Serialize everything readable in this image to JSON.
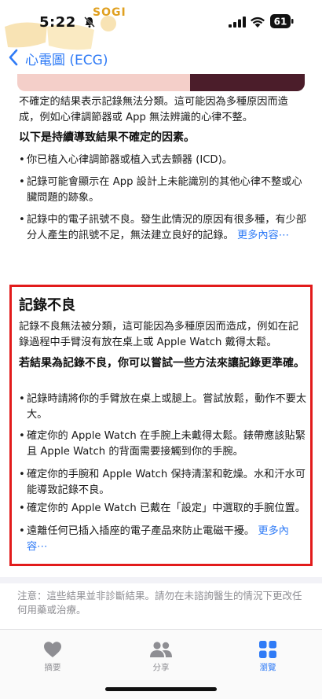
{
  "status_bar": {
    "time": "5:22",
    "watermark": "SOGI",
    "battery": "61"
  },
  "nav": {
    "back_label": "心電圖 (ECG)"
  },
  "intro": {
    "paragraph": "不確定的結果表示記錄無法分類。這可能因為多種原因而造成，例如心律調節器或 App 無法辨識的心律不整。",
    "factors_heading": "以下是持續導致結果不確定的因素。",
    "bullets": [
      "你已植入心律調節器或植入式去顫器 (ICD)。",
      "記錄可能會顯示在 App 設計上未能識別的其他心律不整或心臟問題的跡象。",
      "記錄中的電子訊號不良。發生此情況的原因有很多種，有少部分人產生的訊號不足，無法建立良好的記錄。"
    ],
    "more_label": "更多內容⋯"
  },
  "poor_recording": {
    "title": "記錄不良",
    "paragraph": "記錄不良無法被分類，這可能因為多種原因而造成，例如在記錄過程中手臂沒有放在桌上或 Apple Watch 戴得太鬆。",
    "tips_heading": "若結果為記錄不良，你可以嘗試一些方法來讓記錄更準確。",
    "bullets": [
      "記錄時請將你的手臂放在桌上或腿上。嘗試放鬆，動作不要太大。",
      "確定你的 Apple Watch 在手腕上未戴得太鬆。錶帶應該貼緊且 Apple Watch 的背面需要接觸到你的手腕。",
      "確定你的手腕和 Apple Watch 保持清潔和乾燥。水和汗水可能導致記錄不良。",
      "確定你的 Apple Watch 已戴在「設定」中選取的手腕位置。",
      "遠離任何已插入插座的電子產品來防止電磁干擾。"
    ],
    "more_label": "更多內容⋯"
  },
  "note": "注意：這些結果並非診斷結果。請勿在未諮詢醫生的情況下更改任何用藥或治療。",
  "tabbar": {
    "tabs": [
      {
        "label": "摘要"
      },
      {
        "label": "分享"
      },
      {
        "label": "瀏覽"
      }
    ]
  },
  "colors": {
    "accent": "#2f7bf6",
    "highlight_box": "#e21b1b"
  }
}
